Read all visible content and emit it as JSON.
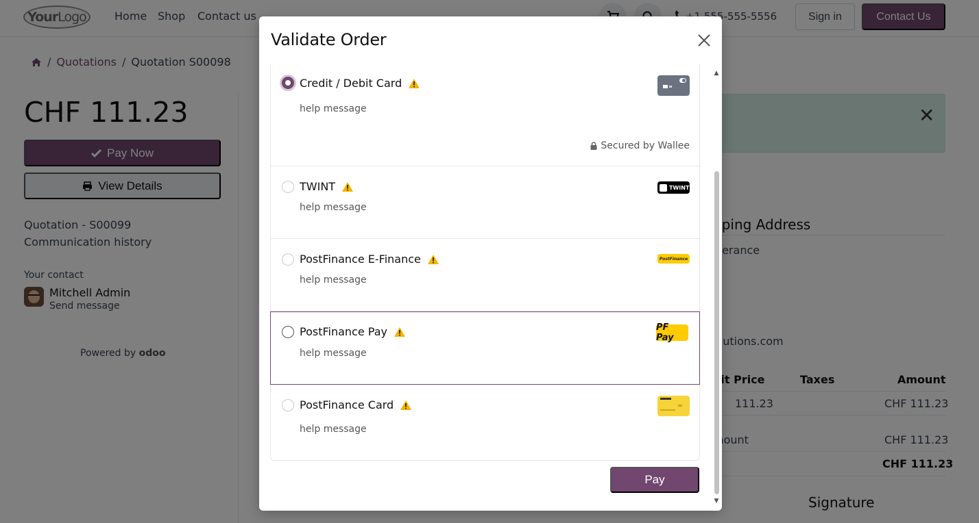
{
  "navbar": {
    "logo_part1": "Your",
    "logo_part2": "Logo",
    "links": [
      "Home",
      "Shop",
      "Contact us"
    ],
    "phone": "+1 555-555-5556",
    "sign_in": "Sign in",
    "contact_us": "Contact Us"
  },
  "breadcrumb": {
    "items": [
      "Quotations",
      "Quotation S00098"
    ],
    "separator": "/"
  },
  "sidebar": {
    "amount": "CHF 111.23",
    "pay_now": "Pay Now",
    "view_details": "View Details",
    "quotation_label": "Quotation - S00099",
    "communication": "Communication history",
    "your_contact": "Your contact",
    "contact_name": "Mitchell Admin",
    "send_message": "Send message",
    "powered_by": "Powered by",
    "powered_brand": "odoo"
  },
  "main": {
    "shipping_title": "pping Address",
    "shipping_name": "werance",
    "shipping_email": "olutions.com",
    "table_headers": [
      "nit Price",
      "Taxes",
      "Amount"
    ],
    "row_unit_price": "111.23",
    "row_amount": "CHF 111.23",
    "untaxed_label": "mount",
    "untaxed_value": "CHF 111.23",
    "total_value": "CHF 111.23",
    "signature": "Signature"
  },
  "modal": {
    "title": "Validate Order",
    "options": [
      {
        "label": "Credit / Debit Card",
        "help": "help message",
        "secured": "Secured by Wallee",
        "selected": true
      },
      {
        "label": "TWINT",
        "help": "help message",
        "selected": false
      },
      {
        "label": "PostFinance E-Finance",
        "help": "help message",
        "selected": false
      },
      {
        "label": "PostFinance Pay",
        "help": "help message",
        "selected": false
      },
      {
        "label": "PostFinance Card",
        "help": "help message",
        "selected": false
      }
    ],
    "logo_twint": "TWINT",
    "logo_postfinance": "PostFinance",
    "logo_pfpay": "PF Pay",
    "pay_button": "Pay"
  },
  "colors": {
    "brand": "#71466f",
    "warning": "#f5b301",
    "alert_bg": "#d3ede4"
  },
  "icons": {
    "home": "home-icon",
    "cart": "cart-icon",
    "search": "search-icon",
    "phone": "phone-icon",
    "check": "check-icon",
    "print": "print-icon",
    "lock": "lock-icon",
    "warning": "warning-icon",
    "close": "close-icon"
  }
}
